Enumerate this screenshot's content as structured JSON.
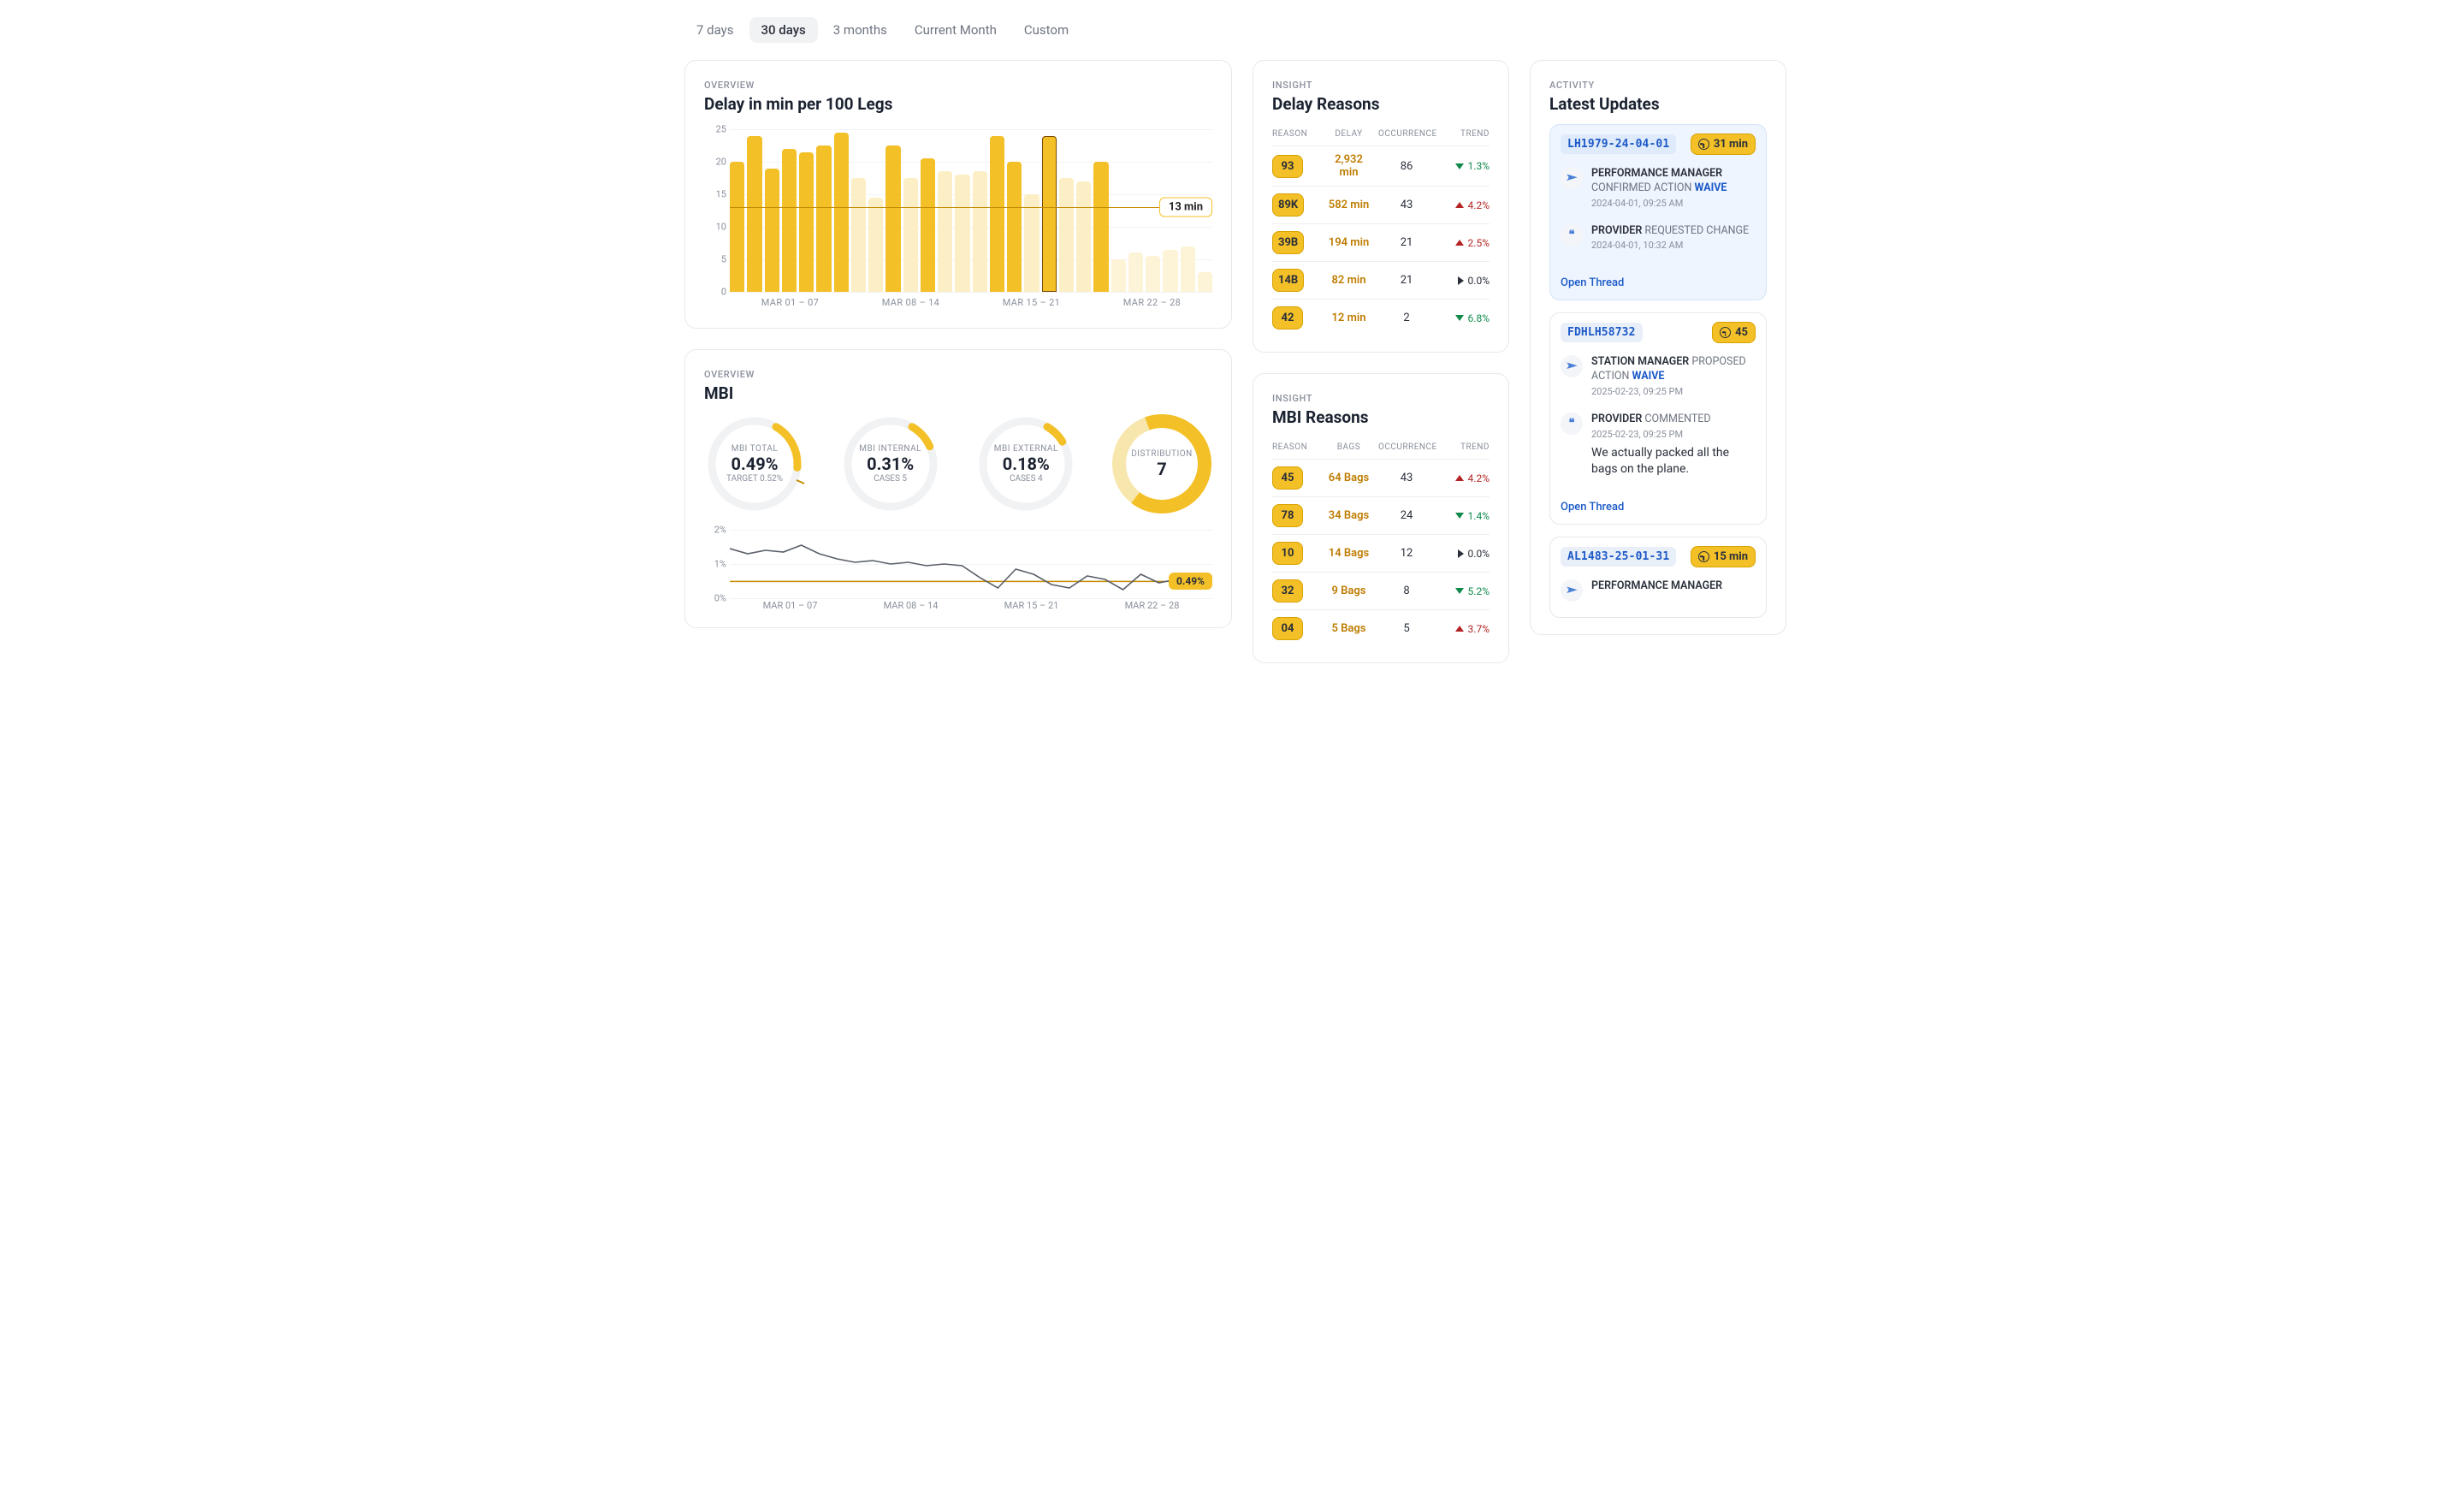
{
  "range_tabs": [
    "7 days",
    "30 days",
    "3 months",
    "Current Month",
    "Custom"
  ],
  "active_tab_index": 1,
  "delay_card": {
    "eyebrow": "OVERVIEW",
    "title": "Delay in min per 100 Legs",
    "avg_label": "13 min",
    "x_groups": [
      "MAR 01 – 07",
      "MAR 08 – 14",
      "MAR 15 – 21",
      "MAR 22 – 28"
    ]
  },
  "mbi_card": {
    "eyebrow": "OVERVIEW",
    "title": "MBI",
    "donuts": [
      {
        "label": "MBI TOTAL",
        "value": "0.49%",
        "sub": "TARGET 0.52%",
        "fill": 0.18,
        "arc_class": "arc",
        "tick": true
      },
      {
        "label": "MBI INTERNAL",
        "value": "0.31%",
        "sub": "CASES 5",
        "fill": 0.1,
        "arc_class": "arc"
      },
      {
        "label": "MBI EXTERNAL",
        "value": "0.18%",
        "sub": "CASES 4",
        "fill": 0.08,
        "arc_class": "arc"
      },
      {
        "label": "DISTRIBUTION",
        "value": "7",
        "sub": "",
        "fill": 0.66,
        "arc_class": "arc thick",
        "bg_arc": true
      }
    ],
    "avg_badge": "0.49%",
    "x_groups": [
      "MAR 01 – 07",
      "MAR 08 – 14",
      "MAR 15 – 21",
      "MAR 22 – 28"
    ]
  },
  "delay_reasons": {
    "eyebrow": "INSIGHT",
    "title": "Delay Reasons",
    "headers": [
      "REASON",
      "DELAY",
      "OCCURRENCE",
      "TREND"
    ],
    "rows": [
      {
        "code": "93",
        "metric": "2,932 min",
        "occ": "86",
        "trend": "down",
        "delta": "1.3%"
      },
      {
        "code": "89K",
        "metric": "582 min",
        "occ": "43",
        "trend": "up",
        "delta": "4.2%"
      },
      {
        "code": "39B",
        "metric": "194 min",
        "occ": "21",
        "trend": "up",
        "delta": "2.5%"
      },
      {
        "code": "14B",
        "metric": "82 min",
        "occ": "21",
        "trend": "neutral",
        "delta": "0.0%"
      },
      {
        "code": "42",
        "metric": "12 min",
        "occ": "2",
        "trend": "down",
        "delta": "6.8%"
      }
    ]
  },
  "mbi_reasons": {
    "eyebrow": "INSIGHT",
    "title": "MBI Reasons",
    "headers": [
      "REASON",
      "BAGS",
      "OCCURRENCE",
      "TREND"
    ],
    "rows": [
      {
        "code": "45",
        "metric": "64 Bags",
        "occ": "43",
        "trend": "up",
        "delta": "4.2%"
      },
      {
        "code": "78",
        "metric": "34 Bags",
        "occ": "24",
        "trend": "down",
        "delta": "1.4%"
      },
      {
        "code": "10",
        "metric": "14 Bags",
        "occ": "12",
        "trend": "neutral",
        "delta": "0.0%"
      },
      {
        "code": "32",
        "metric": "9 Bags",
        "occ": "8",
        "trend": "down",
        "delta": "5.2%"
      },
      {
        "code": "04",
        "metric": "5 Bags",
        "occ": "5",
        "trend": "up",
        "delta": "3.7%"
      }
    ]
  },
  "activity": {
    "eyebrow": "ACTIVITY",
    "title": "Latest Updates",
    "updates": [
      {
        "id": "LH1979-24-04-01",
        "time_badge": "31 min",
        "highlight": true,
        "events": [
          {
            "icon": "plane",
            "title_main": "PERFORMANCE MANAGER",
            "title_rest": "CONFIRMED ACTION ",
            "accent": "WAIVE",
            "time": "2024-04-01, 09:25 AM"
          },
          {
            "icon": "quote",
            "title_main": "PROVIDER",
            "title_rest": "REQUESTED CHANGE",
            "accent": "",
            "time": "2024-04-01, 10:32 AM"
          }
        ],
        "open_thread": "Open Thread"
      },
      {
        "id": "FDHLH58732",
        "time_badge": "45",
        "highlight": false,
        "events": [
          {
            "icon": "plane",
            "title_main": "STATION MANAGER",
            "title_rest": "PROPOSED ACTION ",
            "accent": "WAIVE",
            "time": "2025-02-23, 09:25 PM"
          },
          {
            "icon": "quote",
            "title_main": "PROVIDER",
            "title_rest": " COMMENTED",
            "accent": "",
            "time": "2025-02-23, 09:25 PM",
            "comment": "We actually packed all the bags on the plane."
          }
        ],
        "open_thread": "Open Thread"
      },
      {
        "id": "AL1483-25-01-31",
        "time_badge": "15 min",
        "highlight": false,
        "partial": true,
        "events": [
          {
            "icon": "plane",
            "title_main": "PERFORMANCE MANAGER",
            "title_rest": "",
            "accent": "",
            "time": ""
          }
        ]
      }
    ]
  },
  "chart_data": [
    {
      "type": "bar",
      "title": "Delay in min per 100 Legs",
      "ylabel": "min",
      "ylim": [
        0,
        25
      ],
      "yticks": [
        0,
        5,
        10,
        15,
        20,
        25
      ],
      "target_line": 13,
      "x_groups": [
        "MAR 01 – 07",
        "MAR 08 – 14",
        "MAR 15 – 21",
        "MAR 22 – 28"
      ],
      "values": [
        20,
        24,
        19,
        22,
        21.5,
        22.5,
        24.5,
        17.5,
        14.5,
        22.5,
        17.5,
        20.5,
        18.5,
        18,
        18.5,
        24,
        20,
        15,
        24,
        17.5,
        17,
        20,
        5,
        6,
        5.5,
        6.5,
        7,
        3
      ],
      "emphasis": [
        "strong",
        "strong",
        "strong",
        "strong",
        "strong",
        "strong",
        "strong",
        "weak",
        "weak",
        "strong",
        "weak",
        "strong",
        "weak",
        "weak",
        "weak",
        "strong",
        "strong",
        "weak",
        "sel",
        "weak",
        "weak",
        "strong",
        "extra-weak",
        "extra-weak",
        "extra-weak",
        "extra-weak",
        "extra-weak",
        "extra-weak"
      ]
    },
    {
      "type": "line",
      "title": "MBI",
      "ylabel": "%",
      "ylim": [
        0,
        2
      ],
      "yticks": [
        0,
        1,
        2
      ],
      "target_line": 0.49,
      "x_groups": [
        "MAR 01 – 07",
        "MAR 08 – 14",
        "MAR 15 – 21",
        "MAR 22 – 28"
      ],
      "values": [
        1.45,
        1.3,
        1.4,
        1.35,
        1.55,
        1.3,
        1.15,
        1.05,
        1.1,
        1.0,
        1.05,
        0.95,
        1.0,
        0.95,
        0.6,
        0.3,
        0.85,
        0.7,
        0.4,
        0.3,
        0.65,
        0.55,
        0.25,
        0.7,
        0.45,
        0.55,
        0.3,
        0.45
      ]
    },
    {
      "type": "pie",
      "title": "MBI donuts",
      "series": [
        {
          "name": "MBI TOTAL",
          "value": 0.49,
          "target": 0.52
        },
        {
          "name": "MBI INTERNAL",
          "value": 0.31,
          "cases": 5
        },
        {
          "name": "MBI EXTERNAL",
          "value": 0.18,
          "cases": 4
        },
        {
          "name": "DISTRIBUTION",
          "value": 7
        }
      ]
    }
  ]
}
